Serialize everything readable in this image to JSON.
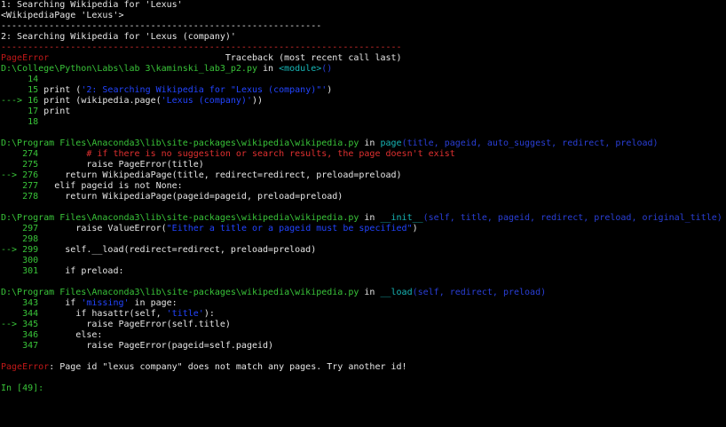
{
  "lines": [
    [
      {
        "t": "1: Searching Wikipedia for 'Lexus'",
        "c": "w"
      }
    ],
    [
      {
        "t": "<WikipediaPage 'Lexus'>",
        "c": "w"
      }
    ],
    [
      {
        "t": "------------------------------------------------------------",
        "c": "w"
      }
    ],
    [
      {
        "t": "2: Searching Wikipedia for 'Lexus (company)'",
        "c": "w"
      }
    ],
    [
      {
        "t": "---------------------------------------------------------------------------",
        "c": "r"
      }
    ],
    [
      {
        "t": "PageError",
        "c": "dr"
      },
      {
        "t": "                                 Traceback (most recent call last)",
        "c": "w"
      }
    ],
    [
      {
        "t": "D:\\College\\Python\\Labs\\lab 3\\kaminski_lab3_p2.py",
        "c": "g"
      },
      {
        "t": " in ",
        "c": "w"
      },
      {
        "t": "<module>",
        "c": "c"
      },
      {
        "t": "()",
        "c": "b"
      }
    ],
    [
      {
        "t": "     14",
        "c": "g"
      }
    ],
    [
      {
        "t": "     15 ",
        "c": "g"
      },
      {
        "t": "print (",
        "c": "w"
      },
      {
        "t": "'2: Searching Wikipedia for \"Lexus (company)\"'",
        "c": "bl"
      },
      {
        "t": ")",
        "c": "w"
      }
    ],
    [
      {
        "t": "---> 16 ",
        "c": "g"
      },
      {
        "t": "print (wikipedia.page(",
        "c": "w"
      },
      {
        "t": "'Lexus (company)'",
        "c": "bl"
      },
      {
        "t": "))",
        "c": "w"
      }
    ],
    [
      {
        "t": "     17 ",
        "c": "g"
      },
      {
        "t": "print",
        "c": "w"
      }
    ],
    [
      {
        "t": "     18",
        "c": "g"
      }
    ],
    [
      {
        "t": "",
        "c": "w"
      }
    ],
    [
      {
        "t": "D:\\Program Files\\Anaconda3\\lib\\site-packages\\wikipedia\\wikipedia.py",
        "c": "g"
      },
      {
        "t": " in ",
        "c": "w"
      },
      {
        "t": "page",
        "c": "c"
      },
      {
        "t": "(title, pageid, auto_suggest, redirect, preload)",
        "c": "b"
      }
    ],
    [
      {
        "t": "    274 ",
        "c": "g"
      },
      {
        "t": "        # if there is no suggestion or search results, the page doesn't exist",
        "c": "r"
      }
    ],
    [
      {
        "t": "    275 ",
        "c": "g"
      },
      {
        "t": "        raise PageError(title)",
        "c": "w"
      }
    ],
    [
      {
        "t": "--> 276 ",
        "c": "g"
      },
      {
        "t": "    return WikipediaPage(title, redirect=redirect, preload=preload)",
        "c": "w"
      }
    ],
    [
      {
        "t": "    277 ",
        "c": "g"
      },
      {
        "t": "  elif pageid is not None:",
        "c": "w"
      }
    ],
    [
      {
        "t": "    278 ",
        "c": "g"
      },
      {
        "t": "    return WikipediaPage(pageid=pageid, preload=preload)",
        "c": "w"
      }
    ],
    [
      {
        "t": "",
        "c": "w"
      }
    ],
    [
      {
        "t": "D:\\Program Files\\Anaconda3\\lib\\site-packages\\wikipedia\\wikipedia.py",
        "c": "g"
      },
      {
        "t": " in ",
        "c": "w"
      },
      {
        "t": "__init__",
        "c": "c"
      },
      {
        "t": "(self, title, pageid, redirect, preload, original_title)",
        "c": "b"
      }
    ],
    [
      {
        "t": "    297 ",
        "c": "g"
      },
      {
        "t": "      raise ValueError(",
        "c": "w"
      },
      {
        "t": "\"Either a title or a pageid must be specified\"",
        "c": "bl"
      },
      {
        "t": ")",
        "c": "w"
      }
    ],
    [
      {
        "t": "    298",
        "c": "g"
      }
    ],
    [
      {
        "t": "--> 299 ",
        "c": "g"
      },
      {
        "t": "    self.__load(redirect=redirect, preload=preload)",
        "c": "w"
      }
    ],
    [
      {
        "t": "    300",
        "c": "g"
      }
    ],
    [
      {
        "t": "    301 ",
        "c": "g"
      },
      {
        "t": "    if preload:",
        "c": "w"
      }
    ],
    [
      {
        "t": "",
        "c": "w"
      }
    ],
    [
      {
        "t": "D:\\Program Files\\Anaconda3\\lib\\site-packages\\wikipedia\\wikipedia.py",
        "c": "g"
      },
      {
        "t": " in ",
        "c": "w"
      },
      {
        "t": "__load",
        "c": "c"
      },
      {
        "t": "(self, redirect, preload)",
        "c": "b"
      }
    ],
    [
      {
        "t": "    343 ",
        "c": "g"
      },
      {
        "t": "    if ",
        "c": "w"
      },
      {
        "t": "'missing'",
        "c": "bl"
      },
      {
        "t": " in page:",
        "c": "w"
      }
    ],
    [
      {
        "t": "    344 ",
        "c": "g"
      },
      {
        "t": "      if hasattr(self, ",
        "c": "w"
      },
      {
        "t": "'title'",
        "c": "bl"
      },
      {
        "t": "):",
        "c": "w"
      }
    ],
    [
      {
        "t": "--> 345 ",
        "c": "g"
      },
      {
        "t": "        raise PageError(self.title)",
        "c": "w"
      }
    ],
    [
      {
        "t": "    346 ",
        "c": "g"
      },
      {
        "t": "      else:",
        "c": "w"
      }
    ],
    [
      {
        "t": "    347 ",
        "c": "g"
      },
      {
        "t": "        raise PageError(pageid=self.pageid)",
        "c": "w"
      }
    ],
    [
      {
        "t": "",
        "c": "w"
      }
    ],
    [
      {
        "t": "PageError",
        "c": "dr"
      },
      {
        "t": ": Page id \"lexus company\" does not match any pages. Try another id!",
        "c": "w"
      }
    ],
    [
      {
        "t": "",
        "c": "w"
      }
    ],
    [
      {
        "t": "In [49]:",
        "c": "g"
      }
    ]
  ]
}
